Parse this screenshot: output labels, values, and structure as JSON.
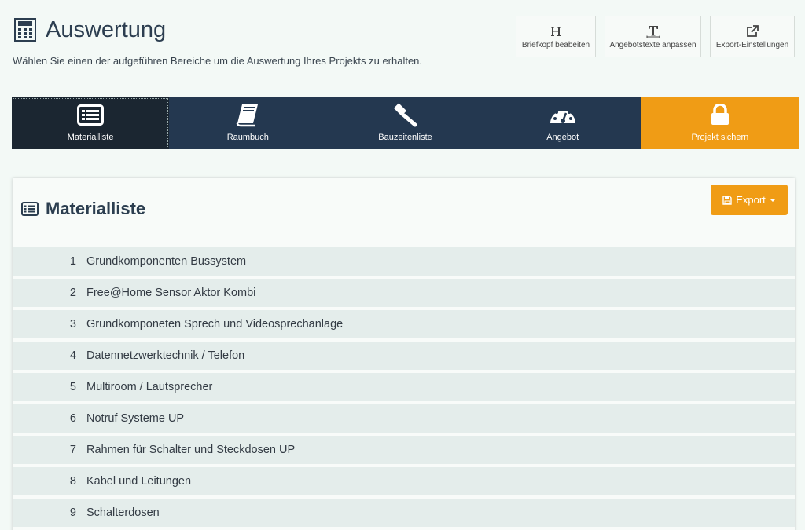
{
  "header": {
    "title": "Auswertung",
    "subtitle": "Wählen Sie einen der aufgeführen Bereiche um die Auswertung Ihres Projekts zu erhalten.",
    "icon": "calculator-icon"
  },
  "top_actions": [
    {
      "label": "Briefkopf beabeiten",
      "icon": "heading-icon"
    },
    {
      "label": "Angebotstexte anpassen",
      "icon": "text-icon"
    },
    {
      "label": "Export-Einstellungen",
      "icon": "external-link-icon"
    }
  ],
  "nav_tabs": [
    {
      "label": "Materialliste",
      "icon": "list-alt-icon",
      "active": true
    },
    {
      "label": "Raumbuch",
      "icon": "book-icon"
    },
    {
      "label": "Bauzeitenliste",
      "icon": "gavel-icon"
    },
    {
      "label": "Angebot",
      "icon": "dashboard-icon"
    },
    {
      "label": "Projekt sichern",
      "icon": "lock-icon"
    }
  ],
  "panel": {
    "title": "Materialliste",
    "icon": "list-alt-icon",
    "export_label": "Export",
    "export_icon": "save-icon"
  },
  "materials": [
    {
      "num": "1",
      "label": "Grundkomponenten Bussystem"
    },
    {
      "num": "2",
      "label": "Free@Home Sensor Aktor Kombi"
    },
    {
      "num": "3",
      "label": "Grundkomponeten Sprech und Videosprechanlage"
    },
    {
      "num": "4",
      "label": "Datennetzwerktechnik / Telefon"
    },
    {
      "num": "5",
      "label": "Multiroom / Lautsprecher"
    },
    {
      "num": "6",
      "label": "Notruf Systeme UP"
    },
    {
      "num": "7",
      "label": "Rahmen für Schalter und Steckdosen UP"
    },
    {
      "num": "8",
      "label": "Kabel und Leitungen"
    },
    {
      "num": "9",
      "label": "Schalterdosen"
    }
  ],
  "colors": {
    "nav_background": "#243850",
    "nav_active": "#1b2631",
    "accent_orange": "#f09c15",
    "page_background": "#f3f9f6",
    "row_background": "#e4edeb"
  }
}
